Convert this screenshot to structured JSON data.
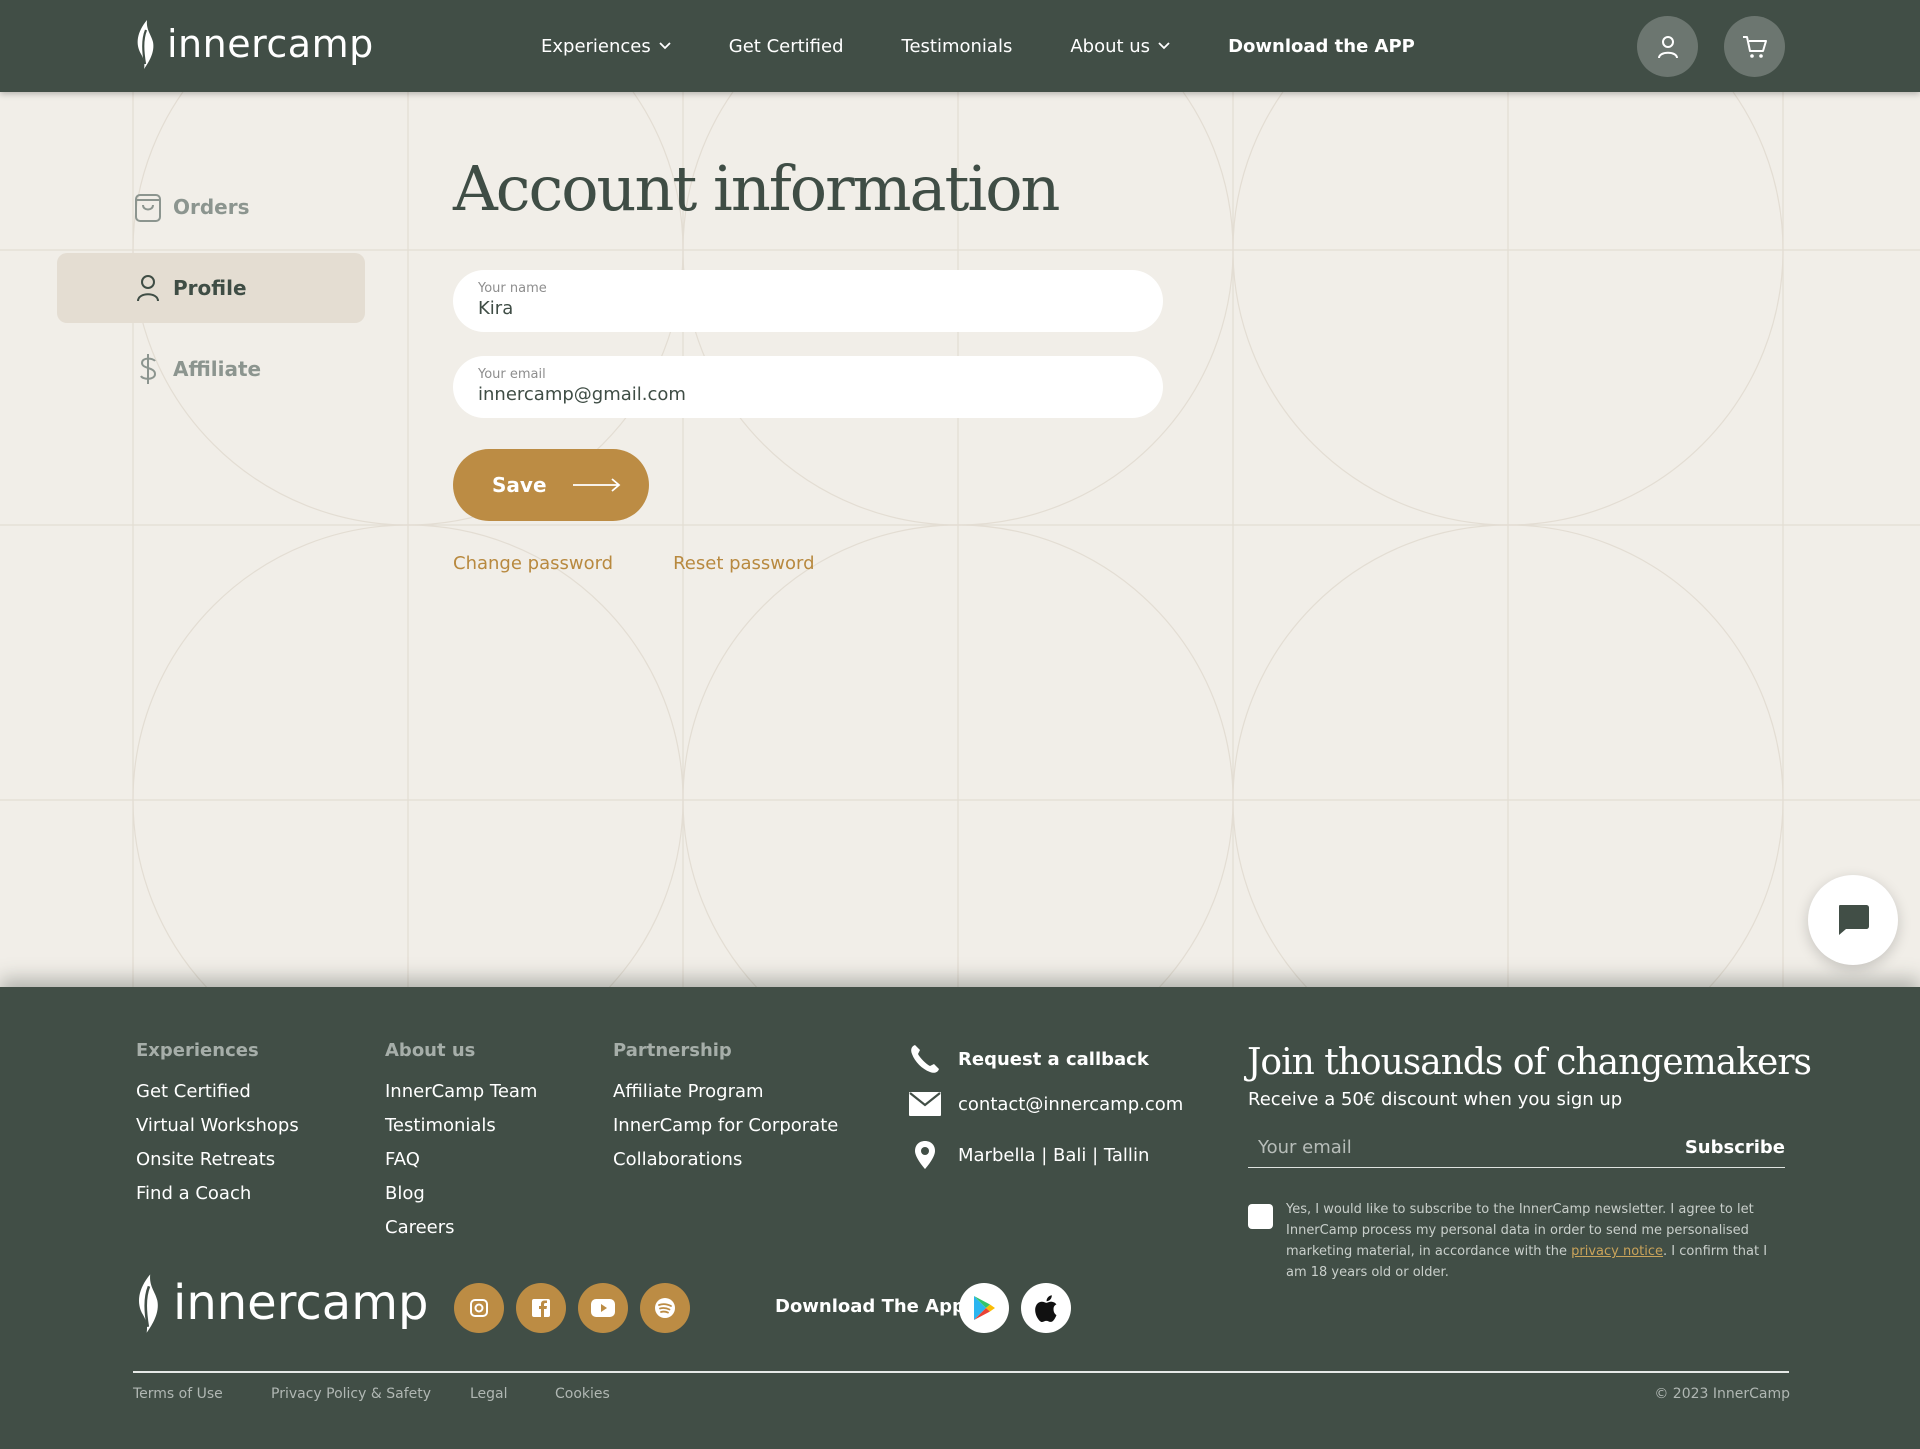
{
  "brand": {
    "name": "innercamp"
  },
  "header": {
    "nav": [
      {
        "label": "Experiences",
        "has_dropdown": true
      },
      {
        "label": "Get Certified",
        "has_dropdown": false
      },
      {
        "label": "Testimonials",
        "has_dropdown": false
      },
      {
        "label": "About us",
        "has_dropdown": true
      }
    ],
    "download_app": "Download the APP",
    "icons": [
      "user-icon",
      "cart-icon"
    ]
  },
  "sidebar": {
    "items": [
      {
        "label": "Orders",
        "icon": "bag-icon",
        "active": false
      },
      {
        "label": "Profile",
        "icon": "user-icon",
        "active": true
      },
      {
        "label": "Affiliate",
        "icon": "dollar-icon",
        "active": false
      }
    ]
  },
  "account": {
    "title": "Account information",
    "name_label": "Your name",
    "name_value": "Kira",
    "email_label": "Your email",
    "email_value": "innercamp@gmail.com",
    "save_label": "Save",
    "change_password": "Change password",
    "reset_password": "Reset password"
  },
  "footer": {
    "columns": [
      {
        "heading": "Experiences",
        "links": [
          "Get Certified",
          "Virtual Workshops",
          "Onsite Retreats",
          "Find a Coach"
        ]
      },
      {
        "heading": "About us",
        "links": [
          "InnerCamp Team",
          "Testimonials",
          "FAQ",
          "Blog",
          "Careers"
        ]
      },
      {
        "heading": "Partnership",
        "links": [
          "Affiliate Program",
          "InnerCamp for Corporate",
          "Collaborations"
        ]
      }
    ],
    "contact": {
      "callback": "Request a callback",
      "email": "contact@innercamp.com",
      "locations": "Marbella | Bali | Tallin"
    },
    "newsletter": {
      "title": "Join thousands of changemakers",
      "subtitle": "Receive a 50€ discount when you sign up",
      "placeholder": "Your email",
      "subscribe": "Subscribe",
      "consent_before": "Yes, I would like to subscribe to the InnerCamp newsletter. I agree to let InnerCamp process my personal data in order to send me personalised marketing material, in accordance with the ",
      "consent_link": "privacy notice",
      "consent_after": ". I confirm that I am 18 years old or older."
    },
    "social": [
      "instagram-icon",
      "facebook-icon",
      "youtube-icon",
      "spotify-icon"
    ],
    "download_app": "Download The App",
    "stores": [
      "google-play-icon",
      "apple-icon"
    ],
    "legal": [
      "Terms of Use",
      "Privacy Policy & Safety",
      "Legal",
      "Cookies"
    ],
    "copyright": "© 2023 InnerCamp"
  },
  "colors": {
    "dark_green": "#414e46",
    "background": "#f1eee8",
    "accent_gold": "#bc8c44",
    "active_sidebar": "#e4ddd2"
  }
}
